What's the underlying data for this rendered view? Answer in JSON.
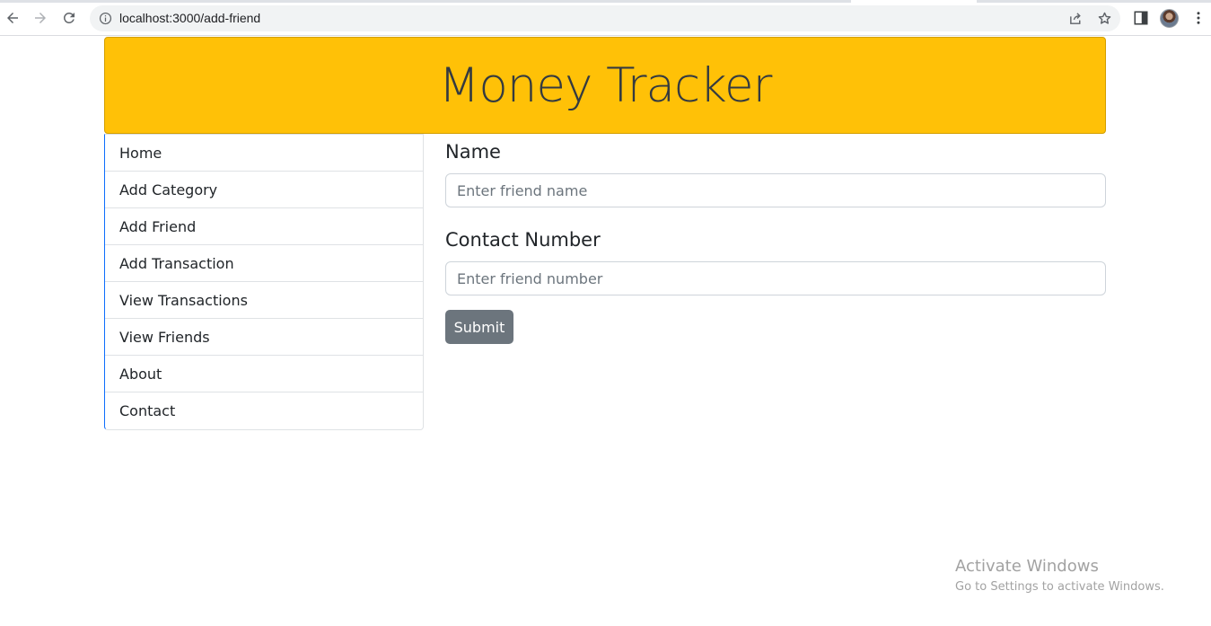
{
  "browser": {
    "url": "localhost:3000/add-friend",
    "icons": [
      "back-arrow-icon",
      "forward-arrow-icon",
      "reload-icon",
      "info-icon",
      "share-icon",
      "star-icon",
      "side-panel-icon",
      "profile-avatar",
      "more-vert-icon"
    ]
  },
  "header": {
    "title": "Money Tracker",
    "background_color": "#ffc107"
  },
  "sidebar": {
    "items": [
      {
        "label": "Home"
      },
      {
        "label": "Add Category"
      },
      {
        "label": "Add Friend"
      },
      {
        "label": "Add Transaction"
      },
      {
        "label": "View Transactions"
      },
      {
        "label": "View Friends"
      },
      {
        "label": "About"
      },
      {
        "label": "Contact"
      }
    ]
  },
  "form": {
    "name_label": "Name",
    "name_placeholder": "Enter friend name",
    "contact_label": "Contact Number",
    "contact_placeholder": "Enter friend number",
    "submit_label": "Submit",
    "submit_color": "#6c757d"
  },
  "watermark": {
    "title": "Activate Windows",
    "subtitle": "Go to Settings to activate Windows."
  }
}
